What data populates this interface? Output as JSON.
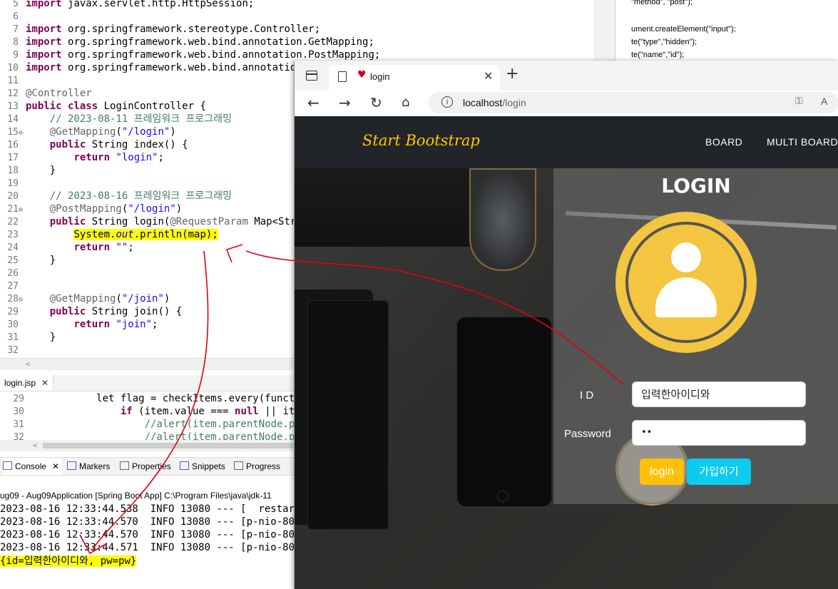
{
  "editor": {
    "lines": [
      {
        "n": "5",
        "t": "import javax.servlet.http.HttpSession;"
      },
      {
        "n": "6",
        "t": ""
      },
      {
        "n": "7",
        "t": "import org.springframework.stereotype.Controller;"
      },
      {
        "n": "8",
        "t": "import org.springframework.web.bind.annotation.GetMapping;"
      },
      {
        "n": "9",
        "t": "import org.springframework.web.bind.annotation.PostMapping;"
      },
      {
        "n": "10",
        "t": "import org.springframework.web.bind.annotation."
      },
      {
        "n": "11",
        "t": ""
      },
      {
        "n": "12",
        "t": "@Controller"
      },
      {
        "n": "13",
        "t": "public class LoginController {"
      },
      {
        "n": "14",
        "t": "    // 2023-08-11 프레임워크 프로그래밍"
      },
      {
        "n": "15",
        "t": "    @GetMapping(\"/login\")"
      },
      {
        "n": "16",
        "t": "    public String index() {"
      },
      {
        "n": "17",
        "t": "        return \"login\";"
      },
      {
        "n": "18",
        "t": "    }"
      },
      {
        "n": "19",
        "t": ""
      },
      {
        "n": "20",
        "t": "    // 2023-08-16 프레임워크 프로그래밍"
      },
      {
        "n": "21",
        "t": "    @PostMapping(\"/login\")"
      },
      {
        "n": "22",
        "t": "    public String login(@RequestParam Map<Strin"
      },
      {
        "n": "23",
        "t": "        System.out.println(map);"
      },
      {
        "n": "24",
        "t": "        return \"\";"
      },
      {
        "n": "25",
        "t": "    }"
      },
      {
        "n": "26",
        "t": ""
      },
      {
        "n": "27",
        "t": ""
      },
      {
        "n": "28",
        "t": "    @GetMapping(\"/join\")"
      },
      {
        "n": "29",
        "t": "    public String join() {"
      },
      {
        "n": "30",
        "t": "        return \"join\";"
      },
      {
        "n": "31",
        "t": "    }"
      },
      {
        "n": "32",
        "t": ""
      }
    ]
  },
  "jspane": {
    "lines": [
      "\"method\", \"post\");",
      "",
      "ument.createElement(\"input\");",
      "te(\"type\",\"hidden\");",
      "te(\"name\",\"id\");"
    ]
  },
  "jsp_tab": {
    "label": "login.jsp"
  },
  "jsp_code": {
    "lines": [
      {
        "n": "29",
        "t": "            let flag = checkItems.every(functi"
      },
      {
        "n": "30",
        "t": "                if (item.value === null || ite"
      },
      {
        "n": "31",
        "t": "                    //alert(item.parentNode.pa"
      },
      {
        "n": "32",
        "t": "                    //alert(item.parentNode.pa"
      }
    ]
  },
  "console": {
    "tabs": [
      "Console",
      "Markers",
      "Properties",
      "Snippets",
      "Progress"
    ],
    "title": "ug09 - Aug09Application [Spring Boot App] C:\\Program Files\\java\\jdk-11",
    "lines": [
      "2023-08-16 12:33:44.538  INFO 13080 --- [  restarted",
      "2023-08-16 12:33:44.570  INFO 13080 --- [p-nio-80-ex",
      "2023-08-16 12:33:44.570  INFO 13080 --- [p-nio-80-ex",
      "2023-08-16 12:33:44.571  INFO 13080 --- [p-nio-80-ex"
    ],
    "output": "{id=입력한아이디와, pw=pw}"
  },
  "browser": {
    "tab_title": "login",
    "url_host": "localhost",
    "url_path": "/login"
  },
  "page": {
    "brand": "Start Bootstrap",
    "nav": [
      "BOARD",
      "MULTI BOARD"
    ],
    "login_title": "LOGIN",
    "id_label": "I D",
    "id_value": "입력한아이디와",
    "pw_label": "Password",
    "pw_value": "••",
    "login_button": "login",
    "join_button": "가입하기"
  },
  "colors": {
    "accent": "#ffc800",
    "avatar": "#f3c540",
    "login_button": "#ffc107",
    "join_button": "#0dcaf0",
    "highlight": "#ffff00",
    "annotation": "#e0000f"
  }
}
